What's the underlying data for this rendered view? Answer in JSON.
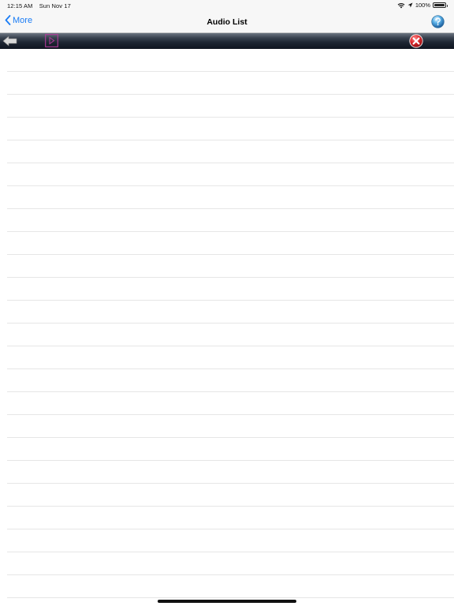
{
  "status_bar": {
    "time": "12:15 AM",
    "date": "Sun Nov 17",
    "battery": "100%",
    "icons": [
      "wifi-icon",
      "location-icon",
      "battery-icon"
    ]
  },
  "nav": {
    "back_label": "More",
    "title": "Audio List",
    "back_icon": "chevron-left-icon",
    "help_icon": "help-icon"
  },
  "toolbar": {
    "icons": [
      "back-arrow-icon",
      "play-icon",
      "close-icon"
    ]
  },
  "colors": {
    "accent": "#1a7cf5",
    "toolbar_dark": "#1d2532",
    "close_red": "#d9262a",
    "play_magenta": "#b23a9b",
    "row_divider": "#e6e6e6"
  },
  "audio_list": {
    "row_count": 24
  }
}
